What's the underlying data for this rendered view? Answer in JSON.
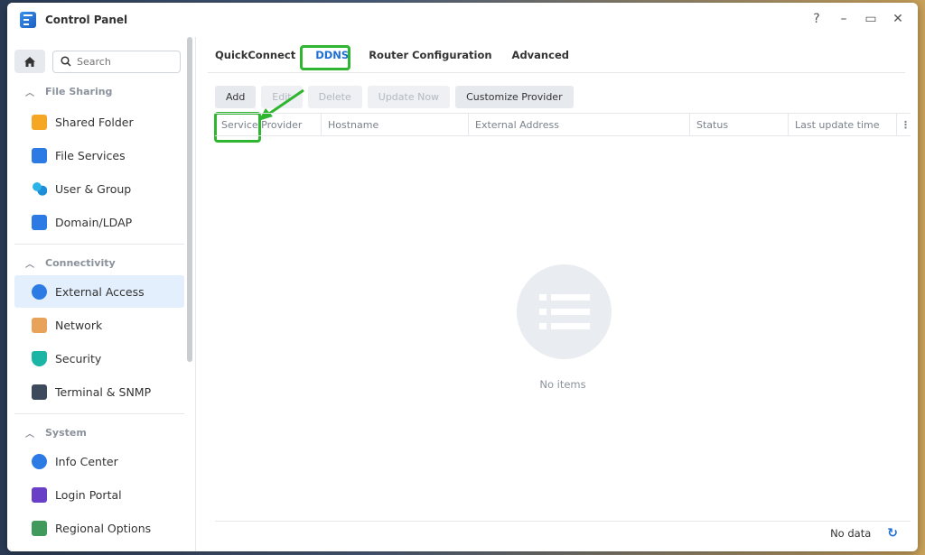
{
  "window": {
    "title": "Control Panel",
    "help": "?",
    "minimize": "–",
    "maximize": "▭",
    "close": "✕"
  },
  "sidebar": {
    "search_placeholder": "Search",
    "sections": [
      {
        "title": "File Sharing",
        "items": [
          "Shared Folder",
          "File Services",
          "User & Group",
          "Domain/LDAP"
        ]
      },
      {
        "title": "Connectivity",
        "items": [
          "External Access",
          "Network",
          "Security",
          "Terminal & SNMP"
        ]
      },
      {
        "title": "System",
        "items": [
          "Info Center",
          "Login Portal",
          "Regional Options"
        ]
      }
    ],
    "active_item": "External Access"
  },
  "tabs": [
    "QuickConnect",
    "DDNS",
    "Router Configuration",
    "Advanced"
  ],
  "active_tab": "DDNS",
  "toolbar": {
    "add": "Add",
    "edit": "Edit",
    "delete": "Delete",
    "update_now": "Update Now",
    "customize_provider": "Customize Provider"
  },
  "table": {
    "columns": [
      "Service Provider",
      "Hostname",
      "External Address",
      "Status",
      "Last update time"
    ],
    "empty_text": "No items"
  },
  "footer": {
    "status": "No data"
  },
  "colors": {
    "accent": "#1f6fd6",
    "highlight": "#2fb52f",
    "active_bg": "#e3effc"
  }
}
